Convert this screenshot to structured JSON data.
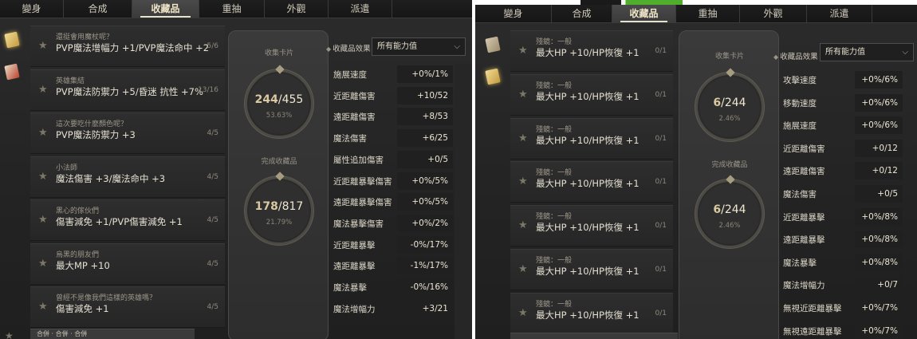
{
  "left": {
    "tabs": [
      {
        "label": "變身",
        "width": 80
      },
      {
        "label": "合成",
        "width": 86
      },
      {
        "label": "收藏品",
        "width": 84,
        "active": true
      },
      {
        "label": "重抽",
        "width": 82
      },
      {
        "label": "外觀",
        "width": 80
      },
      {
        "label": "派遣",
        "width": 80
      }
    ],
    "items": [
      {
        "sub": "還挺會用魔杖呢？",
        "effect": "PVP魔法增幅力 +1/PVP魔法命中 +2",
        "count": "5/6"
      },
      {
        "sub": "英雄集結",
        "effect": "PVP魔法防禦力 +5/昏迷 抗性 +7%",
        "count": "13/16"
      },
      {
        "sub": "這次要吃什麼顏色呢？",
        "effect": "PVP魔法防禦力 +3",
        "count": "4/5"
      },
      {
        "sub": "小法師",
        "effect": "魔法傷害 +3/魔法命中 +3",
        "count": "4/5"
      },
      {
        "sub": "黑心的傢伙們",
        "effect": "傷害減免 +1/PVP傷害減免 +1",
        "count": "4/5"
      },
      {
        "sub": "烏黑的朋友們",
        "effect": "最大MP +10",
        "count": "4/5"
      },
      {
        "sub": "曾經不是像我們這樣的英雄嗎？",
        "effect": "傷害減免 +1",
        "count": "4/5"
      }
    ],
    "bottom_text": "合併 · 合併 · 合併",
    "collect_card_title": "收集卡片",
    "card_count": "244",
    "card_total": "455",
    "card_pct": "53.63%",
    "done_title": "完成收藏品",
    "done_count": "178",
    "done_total": "817",
    "done_pct": "21.79%",
    "filter_label": "收藏品效果",
    "filter_value": "所有能力值",
    "stats": [
      {
        "name": "施展速度",
        "value": "+0%/1%"
      },
      {
        "name": "近距離傷害",
        "value": "+10/52"
      },
      {
        "name": "遠距離傷害",
        "value": "+8/53"
      },
      {
        "name": "魔法傷害",
        "value": "+6/25"
      },
      {
        "name": "屬性追加傷害",
        "value": "+0/5"
      },
      {
        "name": "近距離暴擊傷害",
        "value": "+0%/5%"
      },
      {
        "name": "遠距離暴擊傷害",
        "value": "+0%/5%"
      },
      {
        "name": "魔法暴擊傷害",
        "value": "+0%/2%"
      },
      {
        "name": "近距離暴擊",
        "value": "-0%/17%"
      },
      {
        "name": "遠距離暴擊",
        "value": "-1%/17%"
      },
      {
        "name": "魔法暴擊",
        "value": "-0%/16%"
      },
      {
        "name": "魔法增幅力",
        "value": "+3/21"
      }
    ]
  },
  "right": {
    "tabs": [
      {
        "label": "變身",
        "width": 96
      },
      {
        "label": "合成",
        "width": 76
      },
      {
        "label": "收藏品",
        "width": 80,
        "active": true
      },
      {
        "label": "重抽",
        "width": 80
      },
      {
        "label": "外觀",
        "width": 84
      },
      {
        "label": "派遣",
        "width": 82
      }
    ],
    "items": [
      {
        "sub": "殘鏡：一般",
        "effect": "最大HP +10/HP恢復 +1",
        "count": "0/1"
      },
      {
        "sub": "殘鏡：一般",
        "effect": "最大HP +10/HP恢復 +1",
        "count": "0/1"
      },
      {
        "sub": "殘鏡：一般",
        "effect": "最大HP +10/HP恢復 +1",
        "count": "0/1"
      },
      {
        "sub": "殘鏡：一般",
        "effect": "最大HP +10/HP恢復 +1",
        "count": "0/1"
      },
      {
        "sub": "殘鏡：一般",
        "effect": "最大HP +10/HP恢復 +1",
        "count": "0/1"
      },
      {
        "sub": "殘鏡：一般",
        "effect": "最大HP +10/HP恢復 +1",
        "count": "0/1"
      },
      {
        "sub": "殘鏡：一般",
        "effect": "最大HP +10/HP恢復 +1",
        "count": "0/1"
      }
    ],
    "collect_card_title": "收集卡片",
    "card_count": "6",
    "card_total": "244",
    "card_pct": "2.46%",
    "done_title": "完成收藏品",
    "done_count": "6",
    "done_total": "244",
    "done_pct": "2.46%",
    "filter_label": "收藏品效果",
    "filter_value": "所有能力值",
    "stats": [
      {
        "name": "攻擊速度",
        "value": "+0%/6%"
      },
      {
        "name": "移動速度",
        "value": "+0%/6%"
      },
      {
        "name": "施展速度",
        "value": "+0%/6%"
      },
      {
        "name": "近距離傷害",
        "value": "+0/12"
      },
      {
        "name": "遠距離傷害",
        "value": "+0/12"
      },
      {
        "name": "魔法傷害",
        "value": "+0/5"
      },
      {
        "name": "近距離暴擊",
        "value": "+0%/8%"
      },
      {
        "name": "遠距離暴擊",
        "value": "+0%/8%"
      },
      {
        "name": "魔法暴擊",
        "value": "+0%/8%"
      },
      {
        "name": "魔法增幅力",
        "value": "+0/7"
      },
      {
        "name": "無視近距離暴擊",
        "value": "+0%/7%"
      },
      {
        "name": "無視遠距離暴擊",
        "value": "+0%/7%"
      }
    ]
  }
}
